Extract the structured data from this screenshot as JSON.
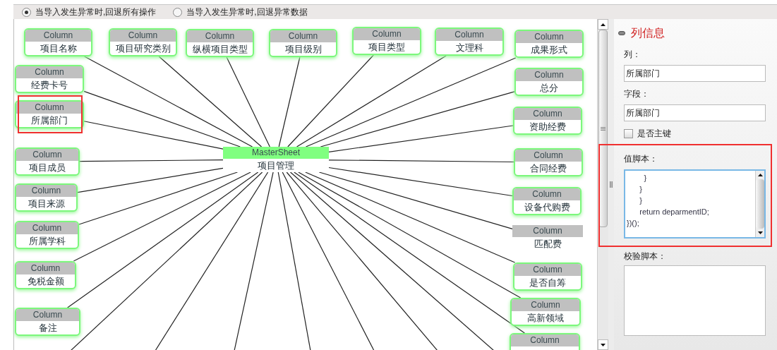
{
  "options": [
    {
      "label": "当导入发生异常时,回退所有操作",
      "selected": true
    },
    {
      "label": "当导入发生异常时,回退异常数据",
      "selected": false
    }
  ],
  "diagram": {
    "master": {
      "type": "MasterSheet",
      "name": "项目管理"
    },
    "nodes": [
      {
        "type": "Column",
        "name": "项目名称",
        "kind": "card",
        "highlighted": false
      },
      {
        "type": "Column",
        "name": "项目研究类别",
        "kind": "card",
        "highlighted": false
      },
      {
        "type": "Column",
        "name": "纵横项目类型",
        "kind": "card",
        "highlighted": false
      },
      {
        "type": "Column",
        "name": "项目级别",
        "kind": "card",
        "highlighted": false
      },
      {
        "type": "Column",
        "name": "项目类型",
        "kind": "card",
        "highlighted": false
      },
      {
        "type": "Column",
        "name": "文理科",
        "kind": "card",
        "highlighted": false
      },
      {
        "type": "Column",
        "name": "成果形式",
        "kind": "card",
        "highlighted": false
      },
      {
        "type": "Column",
        "name": "经费卡号",
        "kind": "card",
        "highlighted": false
      },
      {
        "type": "Column",
        "name": "所属部门",
        "kind": "card",
        "highlighted": true
      },
      {
        "type": "Column",
        "name": "项目成员",
        "kind": "card",
        "highlighted": false
      },
      {
        "type": "Column",
        "name": "项目来源",
        "kind": "card",
        "highlighted": false
      },
      {
        "type": "Column",
        "name": "所属学科",
        "kind": "card",
        "highlighted": false
      },
      {
        "type": "Column",
        "name": "免税金额",
        "kind": "card",
        "highlighted": false
      },
      {
        "type": "Column",
        "name": "备注",
        "kind": "card",
        "highlighted": false
      },
      {
        "type": "Column",
        "name": "总分",
        "kind": "card",
        "highlighted": false
      },
      {
        "type": "Column",
        "name": "资助经费",
        "kind": "card",
        "highlighted": false
      },
      {
        "type": "Column",
        "name": "合同经费",
        "kind": "card",
        "highlighted": false
      },
      {
        "type": "Column",
        "name": "设备代购费",
        "kind": "card",
        "highlighted": false
      },
      {
        "type": "Column",
        "name": "匹配费",
        "kind": "plain",
        "highlighted": false
      },
      {
        "type": "Column",
        "name": "是否自筹",
        "kind": "card",
        "highlighted": false
      },
      {
        "type": "Column",
        "name": "高新领域",
        "kind": "card",
        "highlighted": false
      },
      {
        "type": "Column",
        "kind": "card",
        "highlighted": false
      }
    ]
  },
  "panel": {
    "title": "列信息",
    "column_label": "列：",
    "column_value": "所属部门",
    "field_label": "字段：",
    "field_value": "所属部门",
    "primary_key": {
      "label": "是否主键",
      "checked": false
    },
    "value_script": {
      "label": "值脚本：",
      "highlighted": true,
      "lines": [
        "        }",
        "      }",
        "      }",
        "      return deparmentID;",
        "})();"
      ]
    },
    "validate_script": {
      "label": "校验脚本："
    }
  }
}
